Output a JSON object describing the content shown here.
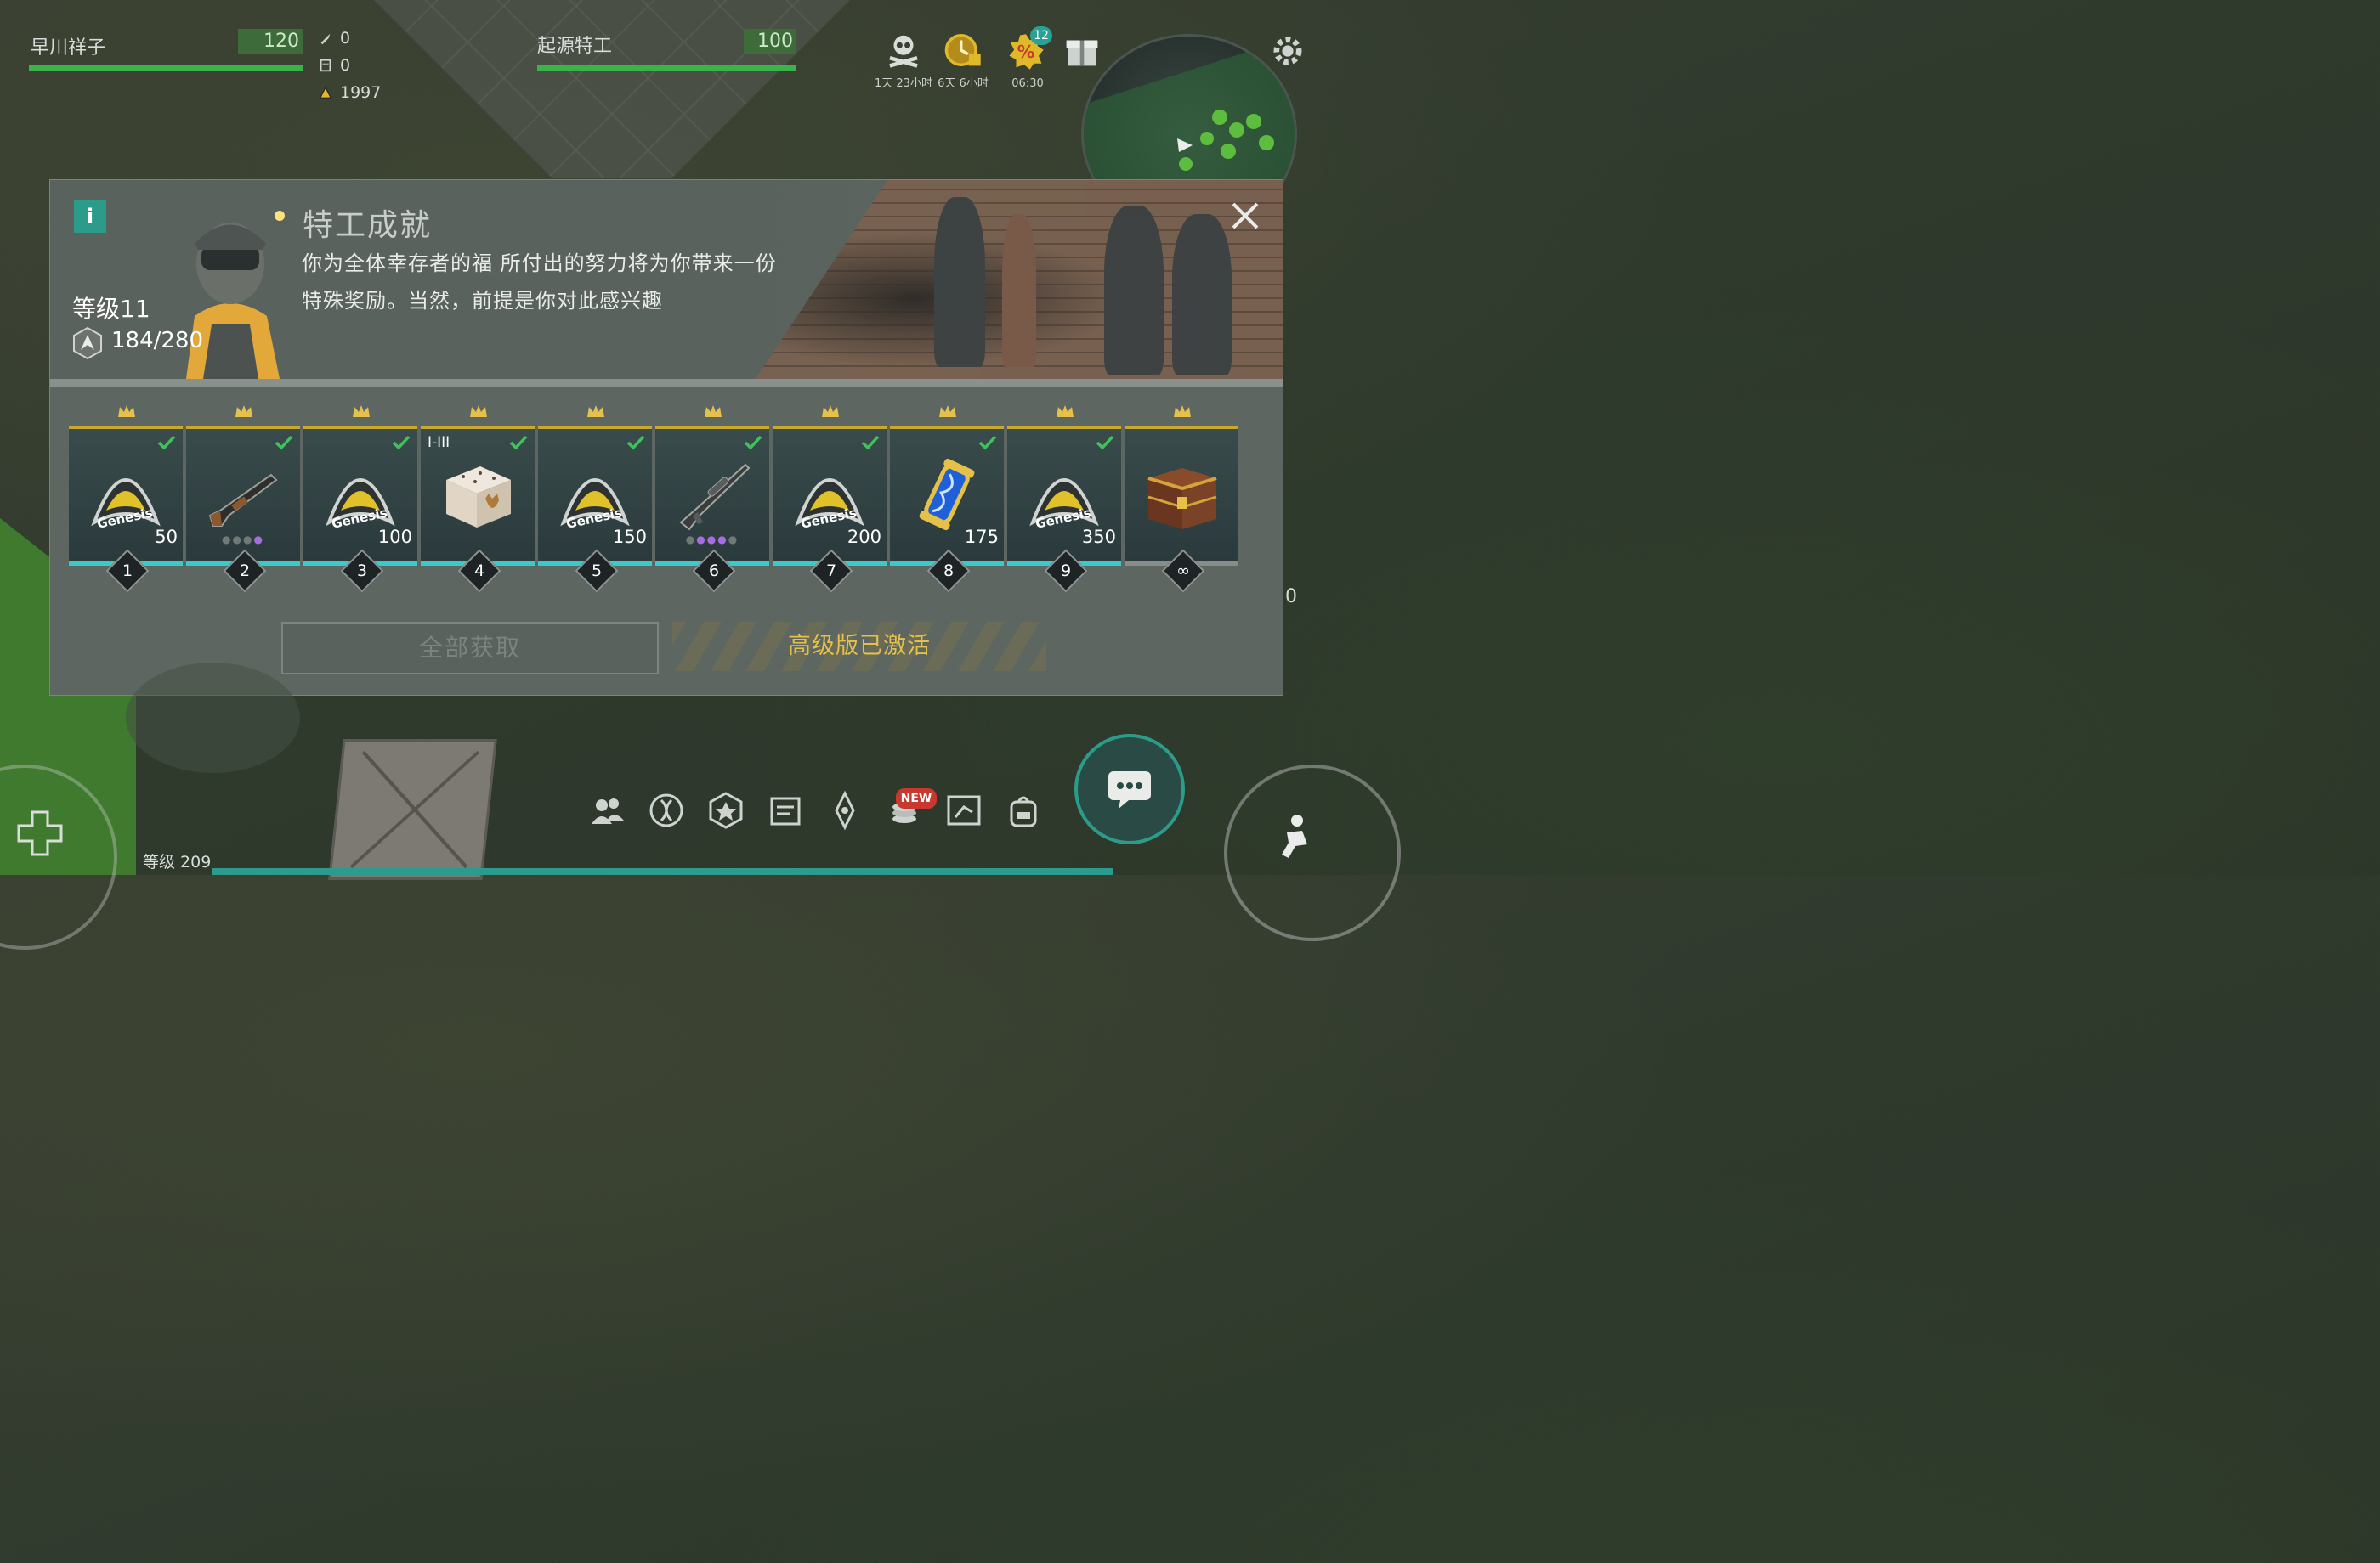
{
  "hud": {
    "player_name": "早川祥子",
    "player_hp": "120",
    "resources": [
      {
        "icon": "rocket-icon",
        "value": "0"
      },
      {
        "icon": "note-icon",
        "value": "0"
      },
      {
        "icon": "genesis-token-icon",
        "value": "1997"
      }
    ],
    "target_name": "起源特工",
    "target_hp": "100",
    "timers": [
      {
        "icon": "skull-icon",
        "label": "1天 23小时"
      },
      {
        "icon": "coin-clock-icon",
        "label": "6天 6小时"
      },
      {
        "icon": "discount-icon",
        "label": "06:30",
        "badge": "12"
      }
    ],
    "gift_icon": "gift-icon"
  },
  "panel": {
    "title": "特工成就",
    "description_line1": "你为全体幸存者的福 所付出的努力将为你带来一份",
    "description_line2": "特殊奖励。当然，前提是你对此感兴趣",
    "level": "等级11",
    "xp": "184/280",
    "rewards": [
      {
        "number": "1",
        "item": "genesis-patch",
        "amount": "50",
        "claimed": true
      },
      {
        "number": "2",
        "item": "shotgun",
        "amount": "",
        "claimed": true,
        "dots": "gray-gray-gray-purple"
      },
      {
        "number": "3",
        "item": "genesis-patch",
        "amount": "100",
        "claimed": true
      },
      {
        "number": "4",
        "item": "cat-crate",
        "amount": "",
        "claimed": true,
        "tier": "I-III"
      },
      {
        "number": "5",
        "item": "genesis-patch",
        "amount": "150",
        "claimed": true
      },
      {
        "number": "6",
        "item": "sniper-rifle",
        "amount": "",
        "claimed": true,
        "dots": "gray-purple-purple-purple-gray"
      },
      {
        "number": "7",
        "item": "genesis-patch",
        "amount": "200",
        "claimed": true
      },
      {
        "number": "8",
        "item": "dna-capsule",
        "amount": "175",
        "claimed": true
      },
      {
        "number": "9",
        "item": "genesis-patch",
        "amount": "350",
        "claimed": true
      },
      {
        "number": "∞",
        "item": "treasure-chest",
        "amount": "",
        "claimed": false
      }
    ],
    "claim_all": "全部获取",
    "premium_status": "高级版已激活"
  },
  "bottom": {
    "level": "等级 209",
    "new_badge": "NEW",
    "side_value": "0"
  },
  "colors": {
    "accent_teal": "#3cc9c7",
    "gold": "#e6c14a",
    "health_green": "#3bb34a"
  }
}
